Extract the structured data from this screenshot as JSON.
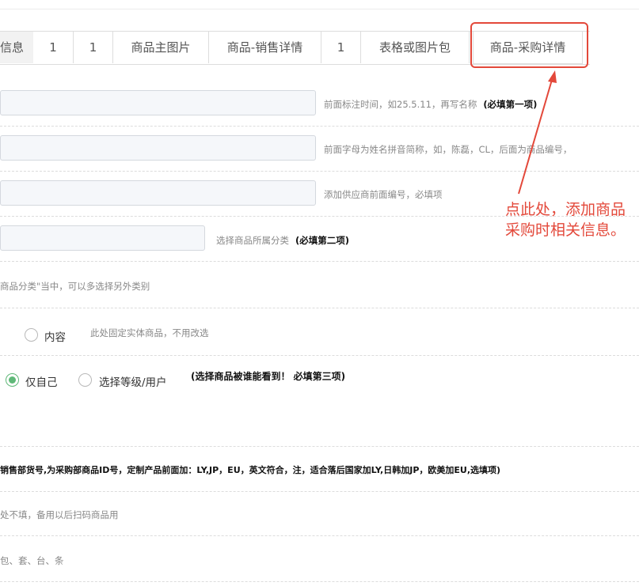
{
  "tabs": [
    {
      "label": "信息"
    },
    {
      "label": "1"
    },
    {
      "label": "1"
    },
    {
      "label": "商品主图片"
    },
    {
      "label": "商品-销售详情"
    },
    {
      "label": "1"
    },
    {
      "label": "表格或图片包"
    },
    {
      "label": "商品-采购详情"
    }
  ],
  "form": {
    "hint1": "前面标注时间，如25.5.11，再写名称",
    "hint1_bold": "(必填第一项)",
    "hint2": "前面字母为姓名拼音简称，如，陈磊，CL，后面为商品编号，",
    "hint3": "添加供应商前面编号，必填项",
    "hint4": "选择商品所属分类",
    "hint4_bold": "(必填第二项)",
    "hint5": "商品分类\"当中，可以多选择另外类别",
    "radio_content_label": "内容",
    "hint6": "此处固定实体商品，不用改选",
    "radio_self_label": "仅自己",
    "radio_level_label": "选择等级/用户",
    "hint7_bold": "(选择商品被谁能看到！ 必填第三项)",
    "bold_line": "销售部货号,为采购部商品ID号，定制产品前面加：LY,JP，EU，英文符合，注，适合落后国家加LY,日韩加JP，欧美加EU,选填项)",
    "hint8": "处不填，备用以后扫码商品用",
    "hint9": "包、套、台、条"
  },
  "annotation": {
    "text": "点此处，添加商品采购时相关信息。",
    "color": "#e3483a"
  },
  "colors": {
    "accent_green": "#5fb878",
    "annotation_red": "#e3483a"
  }
}
